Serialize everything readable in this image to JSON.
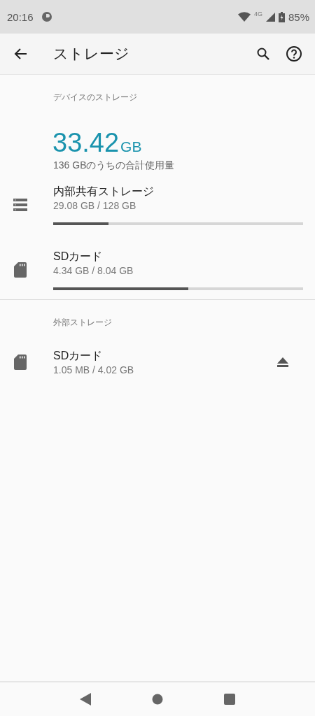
{
  "status_bar": {
    "time": "20:16",
    "network": "4G",
    "battery": "85%"
  },
  "app_bar": {
    "title": "ストレージ"
  },
  "device_storage": {
    "header": "デバイスのストレージ",
    "used_value": "33.42",
    "used_unit": "GB",
    "used_caption": "136 GBのうちの合計使用量",
    "items": [
      {
        "kind": "internal",
        "title": "内部共有ストレージ",
        "usage": "29.08 GB / 128 GB",
        "level": 0.22
      },
      {
        "kind": "sd",
        "title": "SDカード",
        "usage": "4.34 GB / 8.04 GB",
        "level": 0.54
      }
    ]
  },
  "external_storage": {
    "header": "外部ストレージ",
    "items": [
      {
        "kind": "sd",
        "title": "SDカード",
        "usage": "1.05 MB / 4.02 GB"
      }
    ]
  }
}
